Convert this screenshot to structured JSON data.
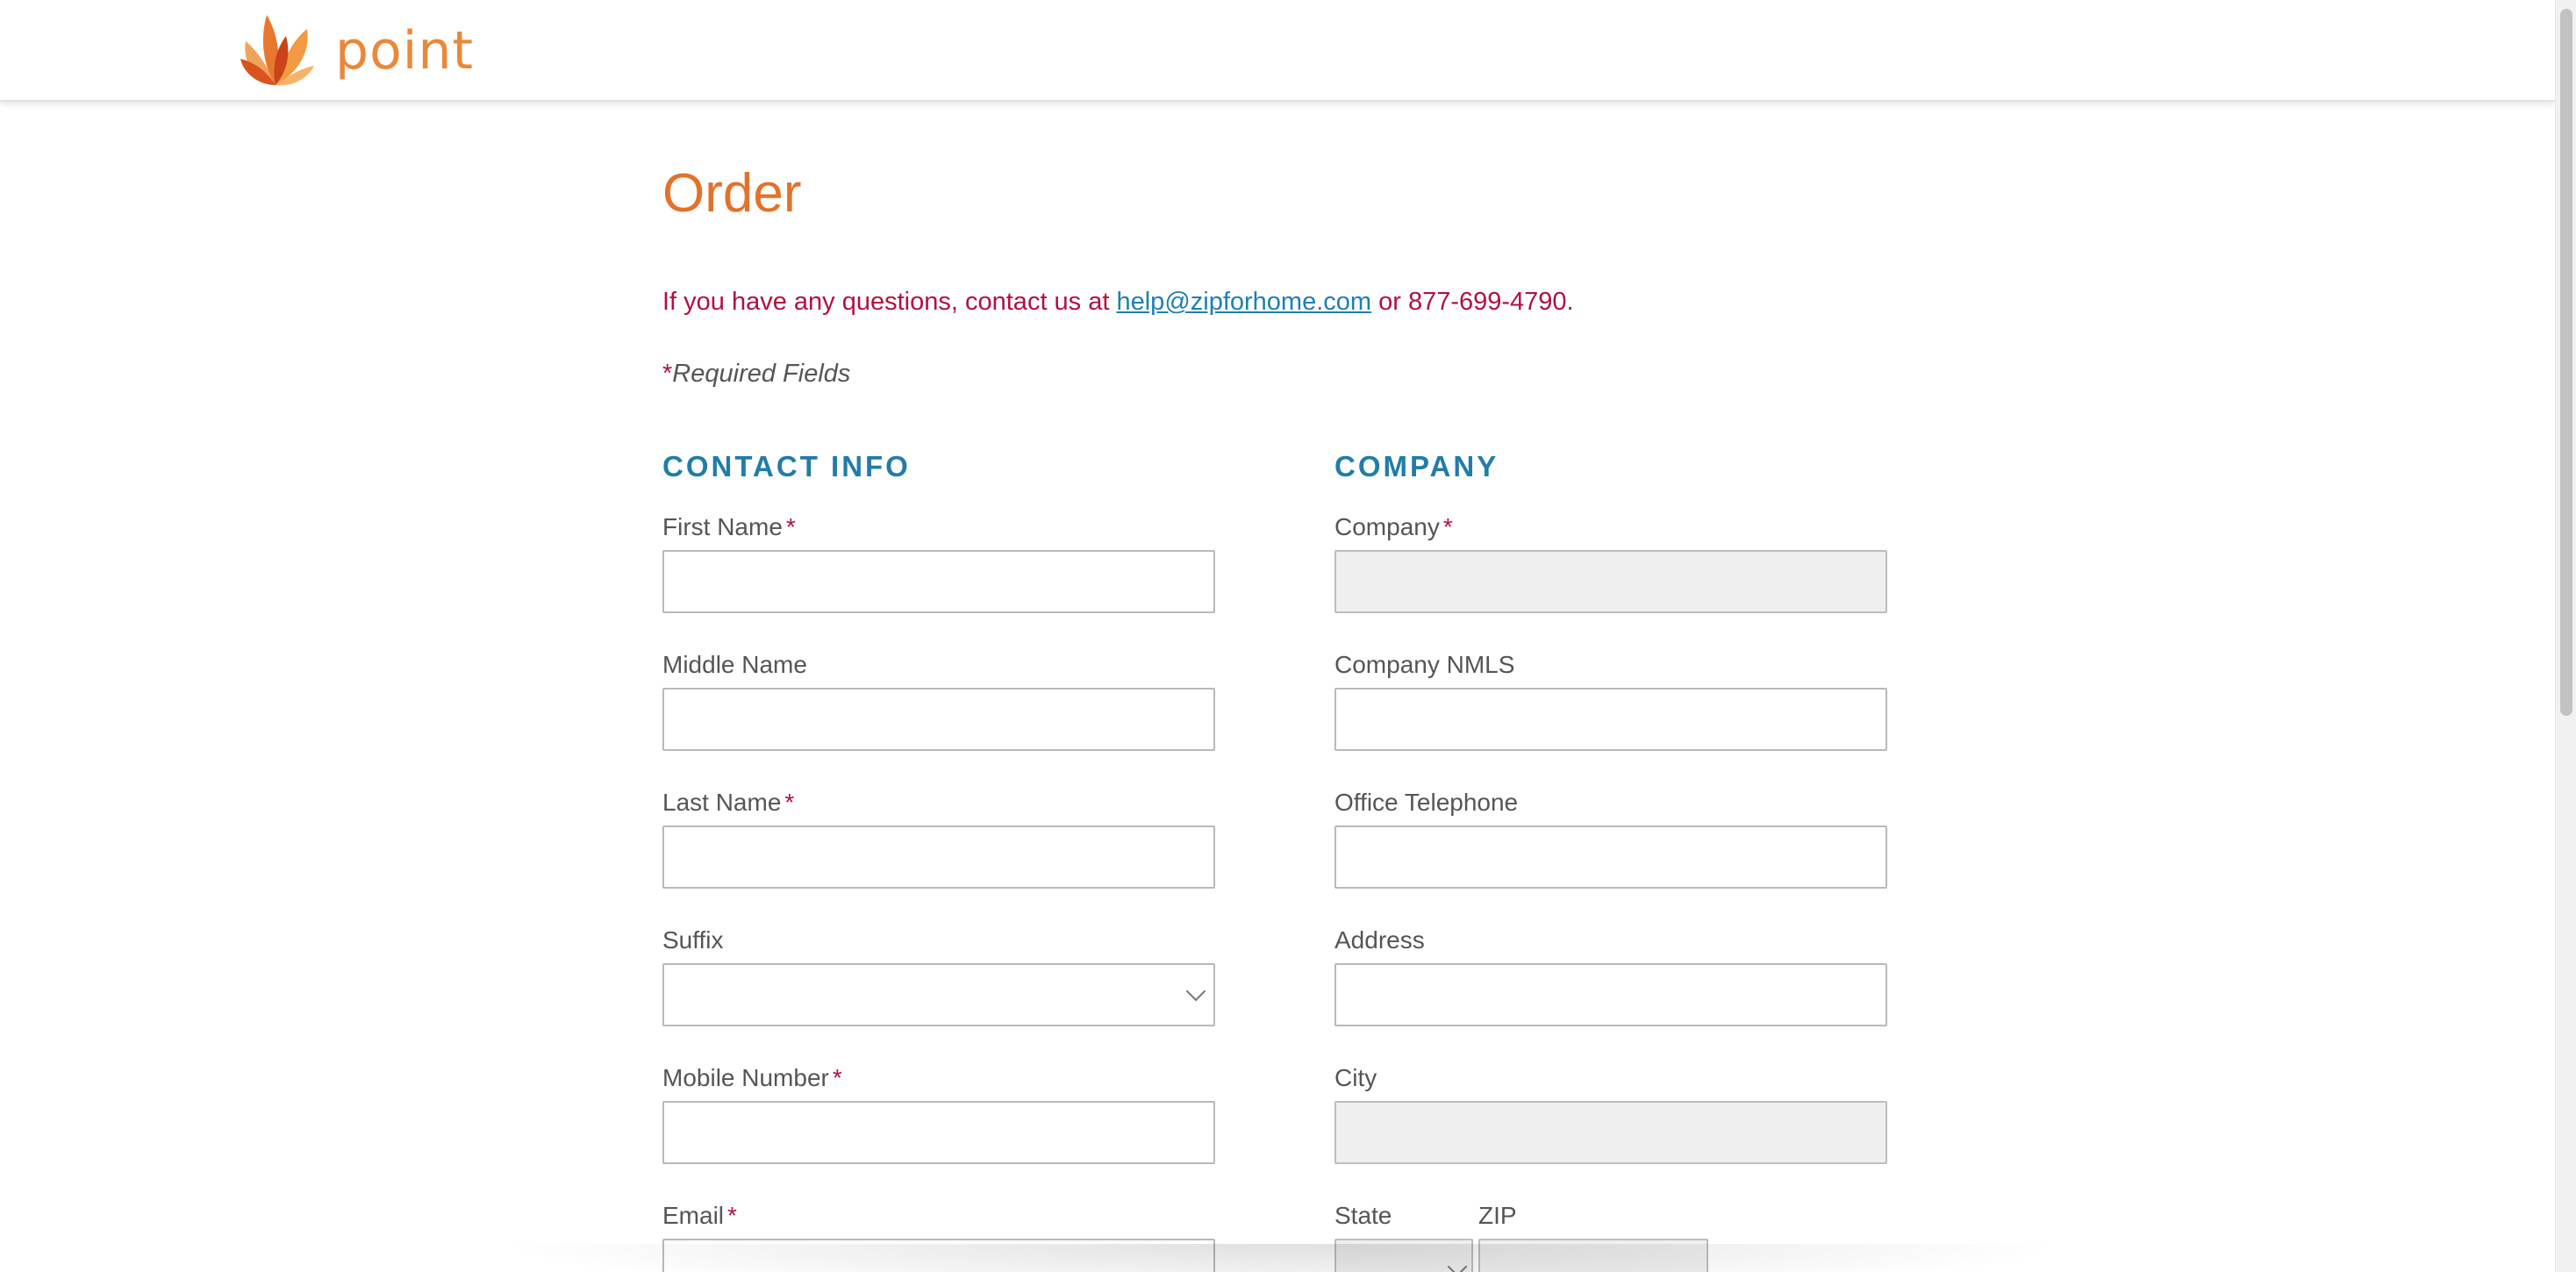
{
  "header": {
    "logo_text": "point",
    "logo_icon": "flame-petal-logo-icon"
  },
  "page": {
    "title": "Order",
    "contact_prefix": "If you have any questions, contact us at ",
    "contact_email": "help@zipforhome.com",
    "contact_suffix": " or 877-699-4790.",
    "required_asterisk": "*",
    "required_text": "Required Fields"
  },
  "contact_info": {
    "heading": "CONTACT INFO",
    "first_name_label": "First Name",
    "middle_name_label": "Middle Name",
    "last_name_label": "Last Name",
    "suffix_label": "Suffix",
    "mobile_label": "Mobile Number",
    "email_label": "Email",
    "required_mark": "*"
  },
  "company": {
    "heading": "COMPANY",
    "company_label": "Company",
    "nmls_label": "Company NMLS",
    "office_phone_label": "Office Telephone",
    "address_label": "Address",
    "city_label": "City",
    "state_label": "State",
    "zip_label": "ZIP",
    "required_mark": "*"
  },
  "colors": {
    "accent_orange": "#e2722b",
    "notice_red": "#b0113f",
    "link_blue": "#1f7fb0",
    "section_blue": "#227ca6"
  }
}
